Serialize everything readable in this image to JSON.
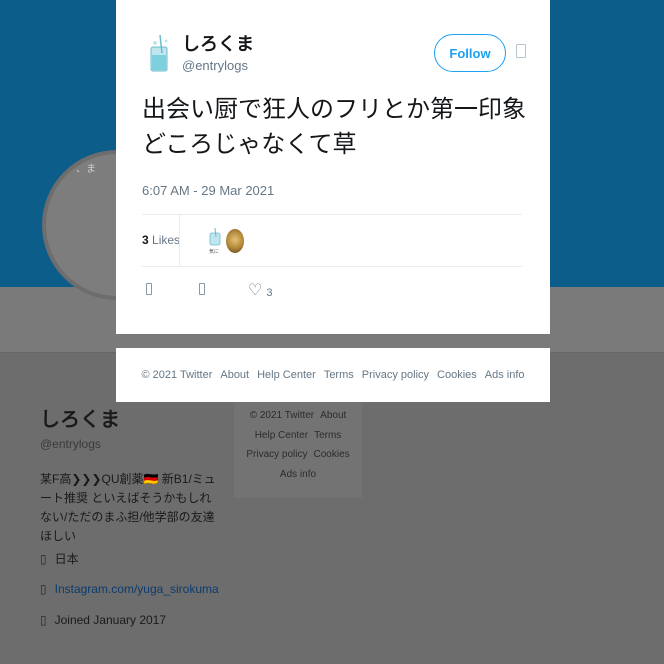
{
  "tweet": {
    "user_name": "しろくま",
    "user_handle": "@entrylogs",
    "follow_label": "Follow",
    "text": "出会い厨で狂人のフリとか第一印象どころじゃなくて草",
    "timestamp": "6:07 AM - 29 Mar 2021",
    "likes_number": "3",
    "likes_label": "Likes",
    "heart_count": "3",
    "avatar_bubble_text": "気に"
  },
  "footer": {
    "copyright": "© 2021 Twitter",
    "about": "About",
    "help": "Help Center",
    "terms": "Terms",
    "privacy": "Privacy policy",
    "cookies": "Cookies",
    "ads": "Ads info"
  },
  "profile": {
    "name": "しろくま",
    "handle": "@entrylogs",
    "bio": "某F高❯❯❯QU創薬🇩🇪 新B1/ミュート推奨 といえばそうかもしれない/ただのまふ担/他学部の友達ほしい",
    "location": "日本",
    "website": "Instagram.com/yuga_sirokuma",
    "joined": "Joined January 2017",
    "avatar_text": "、ま"
  },
  "icons": {
    "reply": "reply-icon",
    "retweet": "retweet-icon",
    "like": "heart-icon",
    "more": "chevron-down-icon",
    "location": "location-icon",
    "link": "link-icon",
    "calendar": "calendar-icon"
  },
  "colors": {
    "accent": "#1da1f2",
    "banner": "#0c5d8a",
    "text": "#14171a",
    "muted": "#657786"
  }
}
